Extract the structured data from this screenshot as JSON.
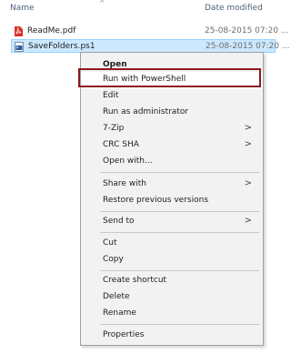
{
  "header": {
    "name_label": "Name",
    "date_label": "Date modified",
    "sort_glyph": "^"
  },
  "files": [
    {
      "name": "ReadMe.pdf",
      "date": "25-08-2015 07:20 ...",
      "icon": "pdf-file-icon",
      "selected": false
    },
    {
      "name": "SaveFolders.ps1",
      "date": "25-08-2015 07:20 ...",
      "icon": "powershell-file-icon",
      "selected": true
    }
  ],
  "context_menu": {
    "items": [
      {
        "label": "Open",
        "bold": true
      },
      {
        "label": "Run with PowerShell",
        "highlighted": true
      },
      {
        "label": "Edit"
      },
      {
        "label": "Run as administrator"
      },
      {
        "label": "7-Zip",
        "submenu": true
      },
      {
        "label": "CRC SHA",
        "submenu": true
      },
      {
        "label": "Open with..."
      },
      {
        "label": "Share with",
        "submenu": true
      },
      {
        "label": "Restore previous versions"
      },
      {
        "label": "Send to",
        "submenu": true
      },
      {
        "label": "Cut"
      },
      {
        "label": "Copy"
      },
      {
        "label": "Create shortcut"
      },
      {
        "label": "Delete"
      },
      {
        "label": "Rename"
      },
      {
        "label": "Properties"
      }
    ],
    "submenu_glyph": ">"
  },
  "colors": {
    "selection": "#cce8ff",
    "highlight_border": "#8b1a1a",
    "menu_bg": "#f2f2f2"
  }
}
